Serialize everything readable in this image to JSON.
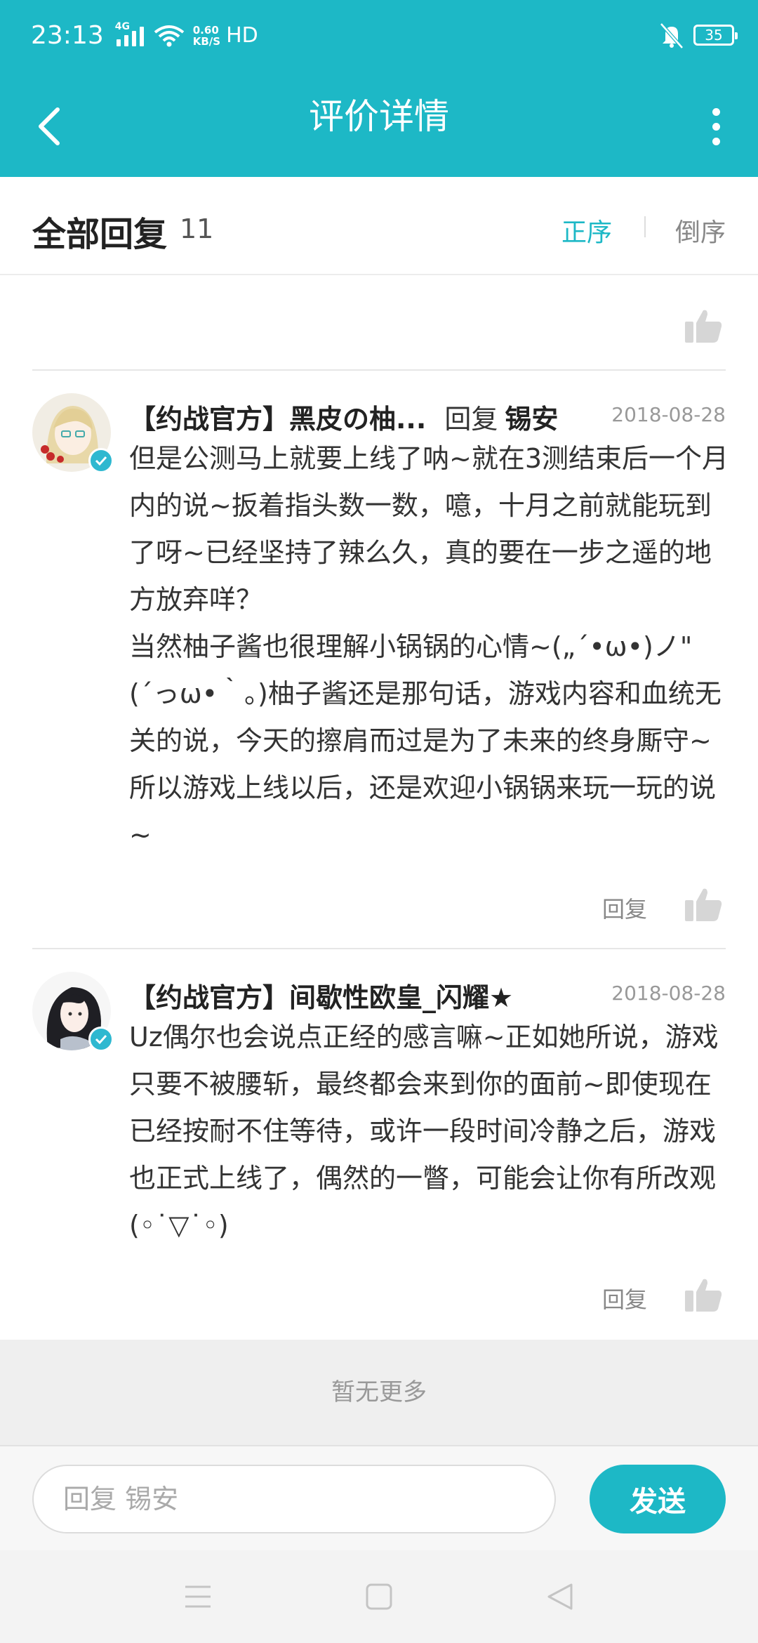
{
  "status_bar": {
    "time": "23:13",
    "network": "4G",
    "speed_value": "0.60",
    "speed_unit": "KB/S",
    "hd": "HD",
    "battery": "35"
  },
  "app_bar": {
    "title": "评价详情"
  },
  "replies_header": {
    "title": "全部回复",
    "count": "11",
    "sort_asc": "正序",
    "sort_desc": "倒序"
  },
  "comments": [
    {
      "author": "【约战官方】黑皮の柚...",
      "reply_word": "回复",
      "reply_to": "锡安",
      "date": "2018-08-28",
      "body": "但是公测马上就要上线了呐~就在3测结束后一个月内的说~扳着指头数一数，噫，十月之前就能玩到了呀~已经坚持了辣么久，真的要在一步之遥的地方放弃咩？\n当然柚子酱也很理解小锅锅的心情~(„´•ω•)ノ\"(´っω•｀。)柚子酱还是那句话，游戏内容和血统无关的说，今天的擦肩而过是为了未来的终身厮守~所以游戏上线以后，还是欢迎小锅锅来玩一玩的说~",
      "reply_label": "回复"
    },
    {
      "author": "【约战官方】间歇性欧皇_闪耀★",
      "date": "2018-08-28",
      "body": "Uz偶尔也会说点正经的感言嘛~正如她所说，游戏只要不被腰斩，最终都会来到你的面前~即使现在已经按耐不住等待，或许一段时间冷静之后，游戏也正式上线了，偶然的一瞥，可能会让你有所改观(◦˙▽˙◦)",
      "reply_label": "回复"
    }
  ],
  "footer": {
    "no_more": "暂无更多"
  },
  "input": {
    "placeholder": "回复 锡安",
    "send_label": "发送"
  },
  "colors": {
    "accent": "#1db8c6",
    "verified": "#2eb8d0"
  },
  "icons": [
    "back-arrow-icon",
    "more-vertical-icon",
    "thumbs-up-icon",
    "verified-check-icon",
    "menu-lines-icon",
    "home-square-icon",
    "back-triangle-icon"
  ]
}
